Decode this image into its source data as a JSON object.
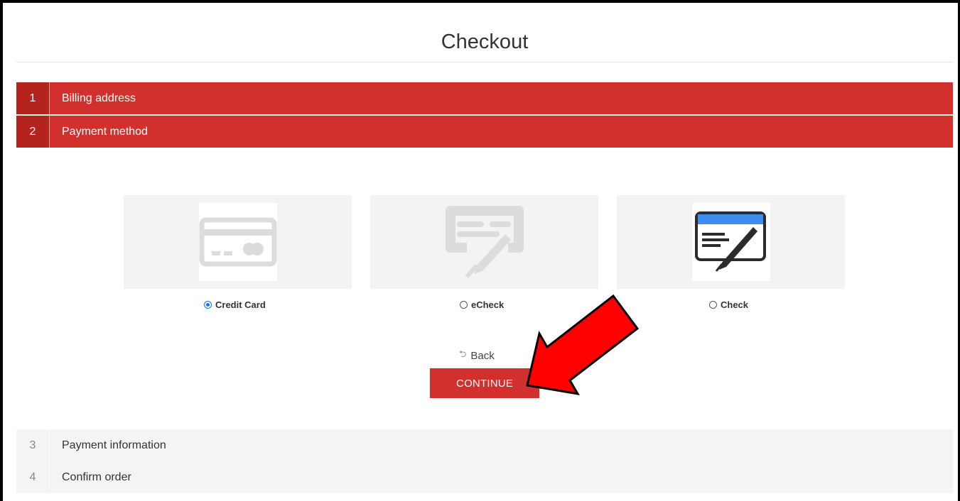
{
  "page": {
    "title": "Checkout"
  },
  "steps": [
    {
      "num": "1",
      "label": "Billing address"
    },
    {
      "num": "2",
      "label": "Payment method"
    },
    {
      "num": "3",
      "label": "Payment information"
    },
    {
      "num": "4",
      "label": "Confirm order"
    }
  ],
  "payment_options": [
    {
      "label": "Credit Card",
      "selected": true,
      "icon": "credit-card-icon"
    },
    {
      "label": "eCheck",
      "selected": false,
      "icon": "echeck-icon"
    },
    {
      "label": "Check",
      "selected": false,
      "icon": "check-icon"
    }
  ],
  "actions": {
    "back_label": "Back",
    "back_icon": "back-arrow-icon",
    "continue_label": "CONTINUE"
  },
  "colors": {
    "accent": "#d2302c",
    "accent_dark": "#b5231f",
    "annotation_arrow": "#ff0000"
  }
}
